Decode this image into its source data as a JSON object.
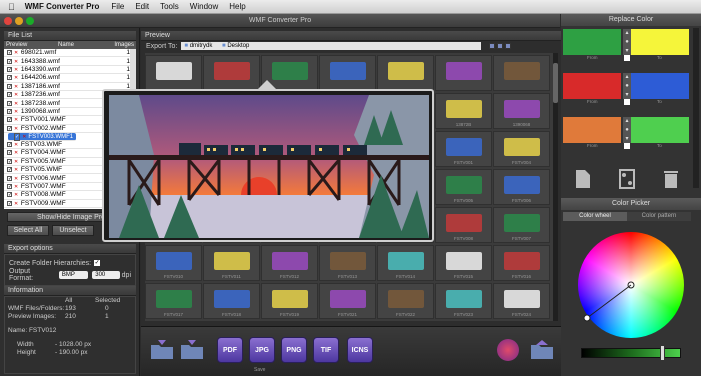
{
  "menubar": {
    "apple": "",
    "app": "WMF Converter Pro",
    "items": [
      "File",
      "Edit",
      "Tools",
      "Window",
      "Help"
    ]
  },
  "window": {
    "title": "WMF Converter Pro"
  },
  "filelist": {
    "header": "File List",
    "columns": [
      "Preview",
      "Name",
      "Images"
    ],
    "files": [
      {
        "name": "698021.wmf",
        "count": "1"
      },
      {
        "name": "1643388.wmf",
        "count": "1"
      },
      {
        "name": "1643390.wmf",
        "count": "1"
      },
      {
        "name": "1644206.wmf",
        "count": "1"
      },
      {
        "name": "1387186.wmf",
        "count": "1"
      },
      {
        "name": "1387236.wmf",
        "count": "1"
      },
      {
        "name": "1387238.wmf",
        "count": "1"
      },
      {
        "name": "1390068.wmf",
        "count": "1"
      },
      {
        "name": "FSTV001.WMF",
        "count": "1"
      },
      {
        "name": "FSTV002.WMF",
        "count": "1"
      },
      {
        "name": "FSTV003.WMF",
        "count": "1"
      },
      {
        "name": "FSTV03.WMF",
        "count": "1"
      },
      {
        "name": "FSTV004.WMF",
        "count": "1"
      },
      {
        "name": "FSTV005.WMF",
        "count": "1"
      },
      {
        "name": "FSTV05.WMF",
        "count": "1"
      },
      {
        "name": "FSTV006.WMF",
        "count": "1"
      },
      {
        "name": "FSTV007.WMF",
        "count": "1"
      },
      {
        "name": "FSTV008.WMF",
        "count": "1"
      },
      {
        "name": "FSTV009.WMF",
        "count": "1"
      }
    ],
    "show_hide": "Show/Hide Image Pre",
    "select_all": "Select All",
    "unselect": "Unselect"
  },
  "export_options": {
    "header": "Export options",
    "folder_label": "Create Folder Hierarchies:",
    "folder_checked": "✓",
    "format_label": "Output Format:",
    "format_value": "BMP",
    "dpi_value": "300",
    "dpi_unit": "dpi"
  },
  "information": {
    "header": "Information",
    "col_all": "All",
    "col_selected": "Selected",
    "row1_label": "WMF Files/Folders:",
    "row1_all": "193",
    "row1_sel": "0",
    "row2_label": "Preview Images:",
    "row2_all": "210",
    "row2_sel": "1",
    "name_line": "Name: FSTV012",
    "width_label": "Width",
    "width_value": "- 1028.00 px",
    "height_label": "Height",
    "height_value": "- 190.00 px"
  },
  "preview": {
    "header": "Preview",
    "export_to": "Export To:",
    "path": [
      "dmitrydk",
      "Desktop"
    ],
    "labels": [
      "13872B",
      "1390068",
      "FSTV001",
      "FSTV004",
      "FSTV005",
      "FSTV006",
      "FSTV008",
      "FSTV007",
      "FSTV010",
      "FSTV011",
      "FSTV012",
      "FSTV013",
      "FSTV014",
      "FSTV015",
      "FSTV016",
      "FSTV017",
      "FSTV018",
      "FSTV019",
      "FSTV021",
      "FSTV022",
      "FSTV023",
      "FSTV024",
      "FSTV025",
      "FSTV026",
      "FSTV027",
      "FSTV028"
    ]
  },
  "toolbar": {
    "buttons": [
      "PDF",
      "JPG",
      "PNG",
      "TIF",
      "ICNS"
    ],
    "save_label": "Save"
  },
  "replace_color": {
    "header": "Replace Color",
    "rows": [
      {
        "from": "#2ea043",
        "to": "#f5f53a",
        "label_from": "From",
        "label_to": "To"
      },
      {
        "from": "#d82a2a",
        "to": "#2d5cd6",
        "label_from": "From",
        "label_to": "To"
      },
      {
        "from": "#e07a3a",
        "to": "#4fcf4f",
        "label_from": "From",
        "label_to": "To"
      }
    ]
  },
  "color_picker": {
    "header": "Color Picker",
    "tab_wheel": "Color wheel",
    "tab_pattern": "Color pattern"
  }
}
